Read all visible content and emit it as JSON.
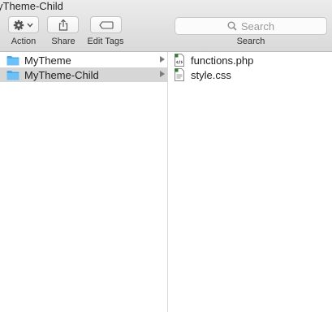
{
  "window": {
    "title": "yTheme-Child"
  },
  "toolbar": {
    "action_label": "Action",
    "share_label": "Share",
    "edit_tags_label": "Edit Tags",
    "search_label": "Search",
    "search_placeholder": "Search"
  },
  "columns": [
    {
      "items": [
        {
          "label": "MyTheme",
          "icon": "folder-icon",
          "selected": false
        },
        {
          "label": "MyTheme-Child",
          "icon": "folder-icon",
          "selected": true
        }
      ]
    },
    {
      "items": [
        {
          "label": "functions.php",
          "icon": "php-file-icon"
        },
        {
          "label": "style.css",
          "icon": "css-file-icon"
        }
      ]
    }
  ],
  "colors": {
    "folder": "#5fb8f2",
    "selection": "#d6d6d6"
  }
}
